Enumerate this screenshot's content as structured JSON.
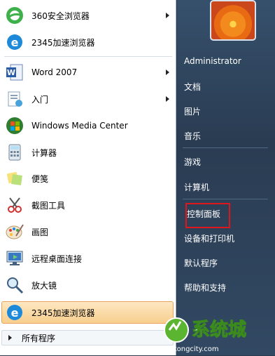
{
  "left_items": [
    {
      "label": "360安全浏览器",
      "icon": "360-browser-icon",
      "submenu": true
    },
    {
      "label": "2345加速浏览器",
      "icon": "ie-browser-icon",
      "submenu": false
    },
    {
      "label": "Word 2007",
      "icon": "word-icon",
      "submenu": true
    },
    {
      "label": "入门",
      "icon": "getting-started-icon",
      "submenu": true
    },
    {
      "label": "Windows Media Center",
      "icon": "media-center-icon",
      "submenu": false
    },
    {
      "label": "计算器",
      "icon": "calculator-icon",
      "submenu": false
    },
    {
      "label": "便笺",
      "icon": "sticky-notes-icon",
      "submenu": false
    },
    {
      "label": "截图工具",
      "icon": "snipping-tool-icon",
      "submenu": false
    },
    {
      "label": "画图",
      "icon": "paint-icon",
      "submenu": false
    },
    {
      "label": "远程桌面连接",
      "icon": "remote-desktop-icon",
      "submenu": false
    },
    {
      "label": "放大镜",
      "icon": "magnifier-icon",
      "submenu": false
    },
    {
      "label": "2345加速浏览器",
      "icon": "ie-browser-icon",
      "submenu": false
    }
  ],
  "all_programs": "所有程序",
  "right_items": [
    {
      "label": "Administrator"
    },
    {
      "label": "文档"
    },
    {
      "label": "图片"
    },
    {
      "label": "音乐"
    },
    {
      "label": "游戏"
    },
    {
      "label": "计算机"
    },
    {
      "label": "控制面板"
    },
    {
      "label": "设备和打印机"
    },
    {
      "label": "默认程序"
    },
    {
      "label": "帮助和支持"
    }
  ],
  "watermark": {
    "title": "系统城",
    "url": "xitongcity.com"
  },
  "colors": {
    "highlight_border": "#e8a25b",
    "callout": "#e0161d",
    "right_pane": "#2b3b4d"
  }
}
